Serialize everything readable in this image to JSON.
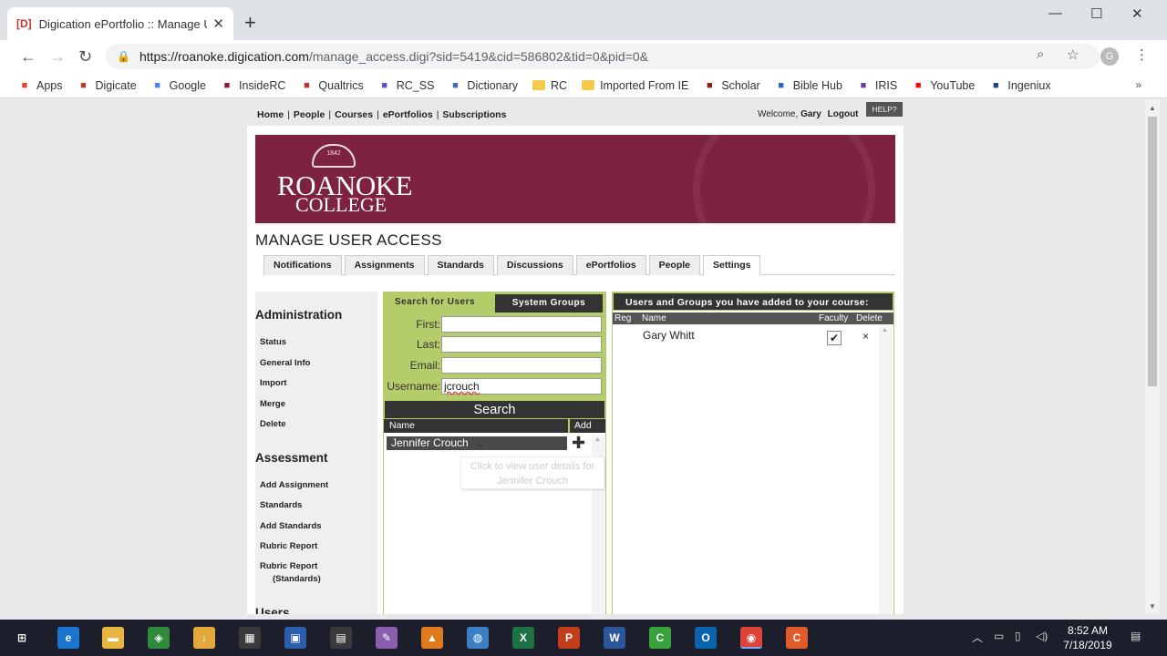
{
  "browser": {
    "tab_favicon": "[D]",
    "tab_title": "Digication ePortfolio :: Manage U",
    "url_domain": "https://roanoke.digication.com",
    "url_path": "/manage_access.digi?sid=5419&cid=586802&tid=0&pid=0&",
    "profile_initial": "G",
    "bookmarks": [
      {
        "label": "Apps",
        "icon": "apps-grid-icon",
        "color": "#e34234"
      },
      {
        "label": "Digicate",
        "icon": "digication-icon",
        "color": "#c0392b"
      },
      {
        "label": "Google",
        "icon": "google-icon",
        "color": "#4285f4"
      },
      {
        "label": "InsideRC",
        "icon": "insiderc-icon",
        "color": "#8e1c38"
      },
      {
        "label": "Qualtrics",
        "icon": "qualtrics-icon",
        "color": "#d62828"
      },
      {
        "label": "RC_SS",
        "icon": "rcss-icon",
        "color": "#5a4fcf"
      },
      {
        "label": "Dictionary",
        "icon": "dictionary-icon",
        "color": "#3b6fb6"
      },
      {
        "label": "RC",
        "icon": "folder-icon",
        "color": "#f5c94a"
      },
      {
        "label": "Imported From IE",
        "icon": "folder-icon",
        "color": "#f5c94a"
      },
      {
        "label": "Scholar",
        "icon": "scholar-icon",
        "color": "#8b1a1a"
      },
      {
        "label": "Bible Hub",
        "icon": "biblehub-icon",
        "color": "#2a64c5"
      },
      {
        "label": "IRIS",
        "icon": "iris-icon",
        "color": "#6c3fa0"
      },
      {
        "label": "YouTube",
        "icon": "youtube-icon",
        "color": "#ff0000"
      },
      {
        "label": "Ingeniux",
        "icon": "ingeniux-icon",
        "color": "#1f3f8f"
      }
    ],
    "bookmarks_more": "»"
  },
  "site": {
    "nav": [
      "Home",
      "People",
      "Courses",
      "ePortfolios",
      "Subscriptions"
    ],
    "welcome_prefix": "Welcome,",
    "user": "Gary",
    "logout": "Logout",
    "help": "HELP?",
    "logo_year": "1842",
    "logo_line1": "ROANOKE",
    "logo_line2": "COLLEGE",
    "page_title": "MANAGE USER ACCESS",
    "tabs": [
      "Notifications",
      "Assignments",
      "Standards",
      "Discussions",
      "ePortfolios",
      "People",
      "Settings"
    ],
    "active_tab": "Settings"
  },
  "sidebar": {
    "administration": {
      "heading": "Administration",
      "items": [
        "Status",
        "General Info",
        "Import",
        "Merge",
        "Delete"
      ]
    },
    "assessment": {
      "heading": "Assessment",
      "items": [
        "Add Assignment",
        "Standards",
        "Add Standards",
        "Rubric Report",
        "Rubric Report",
        "(Standards)"
      ]
    },
    "users_heading": "Users"
  },
  "search": {
    "tab_search_users": "Search for Users",
    "tab_system_groups": "System Groups",
    "first_label": "First:",
    "first_value": "",
    "last_label": "Last:",
    "last_value": "",
    "email_label": "Email:",
    "email_value": "",
    "username_label": "Username:",
    "username_value": "jcrouch",
    "search_button": "Search",
    "col_name": "Name",
    "col_add": "Add",
    "result_name": "Jennifer Crouch",
    "add_symbol": "✚",
    "tooltip_line1": "Click to view user details for",
    "tooltip_line2": "Jennifer Crouch"
  },
  "added": {
    "header": "Users and Groups you have added to your course:",
    "col_reg": "Reg",
    "col_name": "Name",
    "col_faculty": "Faculty",
    "col_delete": "Delete",
    "row_name": "Gary Whitt",
    "row_checkmark": "✔",
    "row_delete": "×"
  },
  "taskbar": {
    "time": "8:52 AM",
    "date": "7/18/2019",
    "icons": [
      {
        "name": "windows-start-icon",
        "color": "#1c1f2b",
        "glyph": "⊞"
      },
      {
        "name": "edge-icon",
        "color": "#1b75d0",
        "glyph": "e"
      },
      {
        "name": "file-explorer-icon",
        "color": "#e8b63f",
        "glyph": "▬"
      },
      {
        "name": "green-app-icon",
        "color": "#2f8a3c",
        "glyph": "◈"
      },
      {
        "name": "file-download-icon",
        "color": "#e5a83a",
        "glyph": "↓"
      },
      {
        "name": "calculator-icon",
        "color": "#3a3a3a",
        "glyph": "▦"
      },
      {
        "name": "remote-desktop-icon",
        "color": "#2b5fad",
        "glyph": "▣"
      },
      {
        "name": "store-icon",
        "color": "#3a3a3a",
        "glyph": "▤"
      },
      {
        "name": "paint-icon",
        "color": "#8a5fb0",
        "glyph": "✎"
      },
      {
        "name": "tool-icon",
        "color": "#e07a1f",
        "glyph": "▲"
      },
      {
        "name": "globe-icon",
        "color": "#3c7fc4",
        "glyph": "◍"
      },
      {
        "name": "excel-icon",
        "color": "#1e7145",
        "glyph": "X"
      },
      {
        "name": "powerpoint-icon",
        "color": "#c43e1c",
        "glyph": "P"
      },
      {
        "name": "word-icon",
        "color": "#2b579a",
        "glyph": "W"
      },
      {
        "name": "camtasia-icon",
        "color": "#3aa23a",
        "glyph": "C"
      },
      {
        "name": "outlook-icon",
        "color": "#0a64ad",
        "glyph": "O"
      },
      {
        "name": "chrome-icon",
        "color": "#db4437",
        "glyph": "◉"
      },
      {
        "name": "camtasia-recorder-icon",
        "color": "#e05a2a",
        "glyph": "C"
      }
    ]
  }
}
